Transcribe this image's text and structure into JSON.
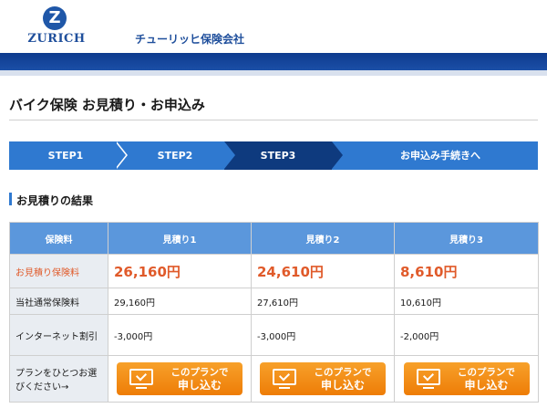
{
  "header": {
    "logo_letter": "Z",
    "logo_word": "ZURICH",
    "company": "チューリッヒ保険会社"
  },
  "page_title": "バイク保険 お見積り・お申込み",
  "steps": [
    {
      "label": "STEP1",
      "active": false
    },
    {
      "label": "STEP2",
      "active": false
    },
    {
      "label": "STEP3",
      "active": true
    },
    {
      "label": "お申込み手続きへ",
      "active": false
    }
  ],
  "section_title": "お見積りの結果",
  "table": {
    "header": [
      "保険料",
      "見積り1",
      "見積り2",
      "見積り3"
    ],
    "rows": [
      {
        "label": "お見積り保険料",
        "values": [
          "26,160円",
          "24,610円",
          "8,610円"
        ]
      },
      {
        "label": "当社通常保険料",
        "values": [
          "29,160円",
          "27,610円",
          "10,610円"
        ]
      },
      {
        "label": "インターネット割引",
        "values": [
          "-3,000円",
          "-3,000円",
          "-2,000円"
        ]
      }
    ],
    "select_label": "プランをひとつお選びください→",
    "button_line1": "このプランで",
    "button_line2": "申し込む"
  },
  "colors": {
    "brand_blue": "#1f4f9c",
    "step_blue": "#2f79d0",
    "step_active": "#0e3a7e",
    "table_header": "#5b97dc",
    "price_red": "#e05a2a",
    "button_orange": "#ee7d07"
  }
}
